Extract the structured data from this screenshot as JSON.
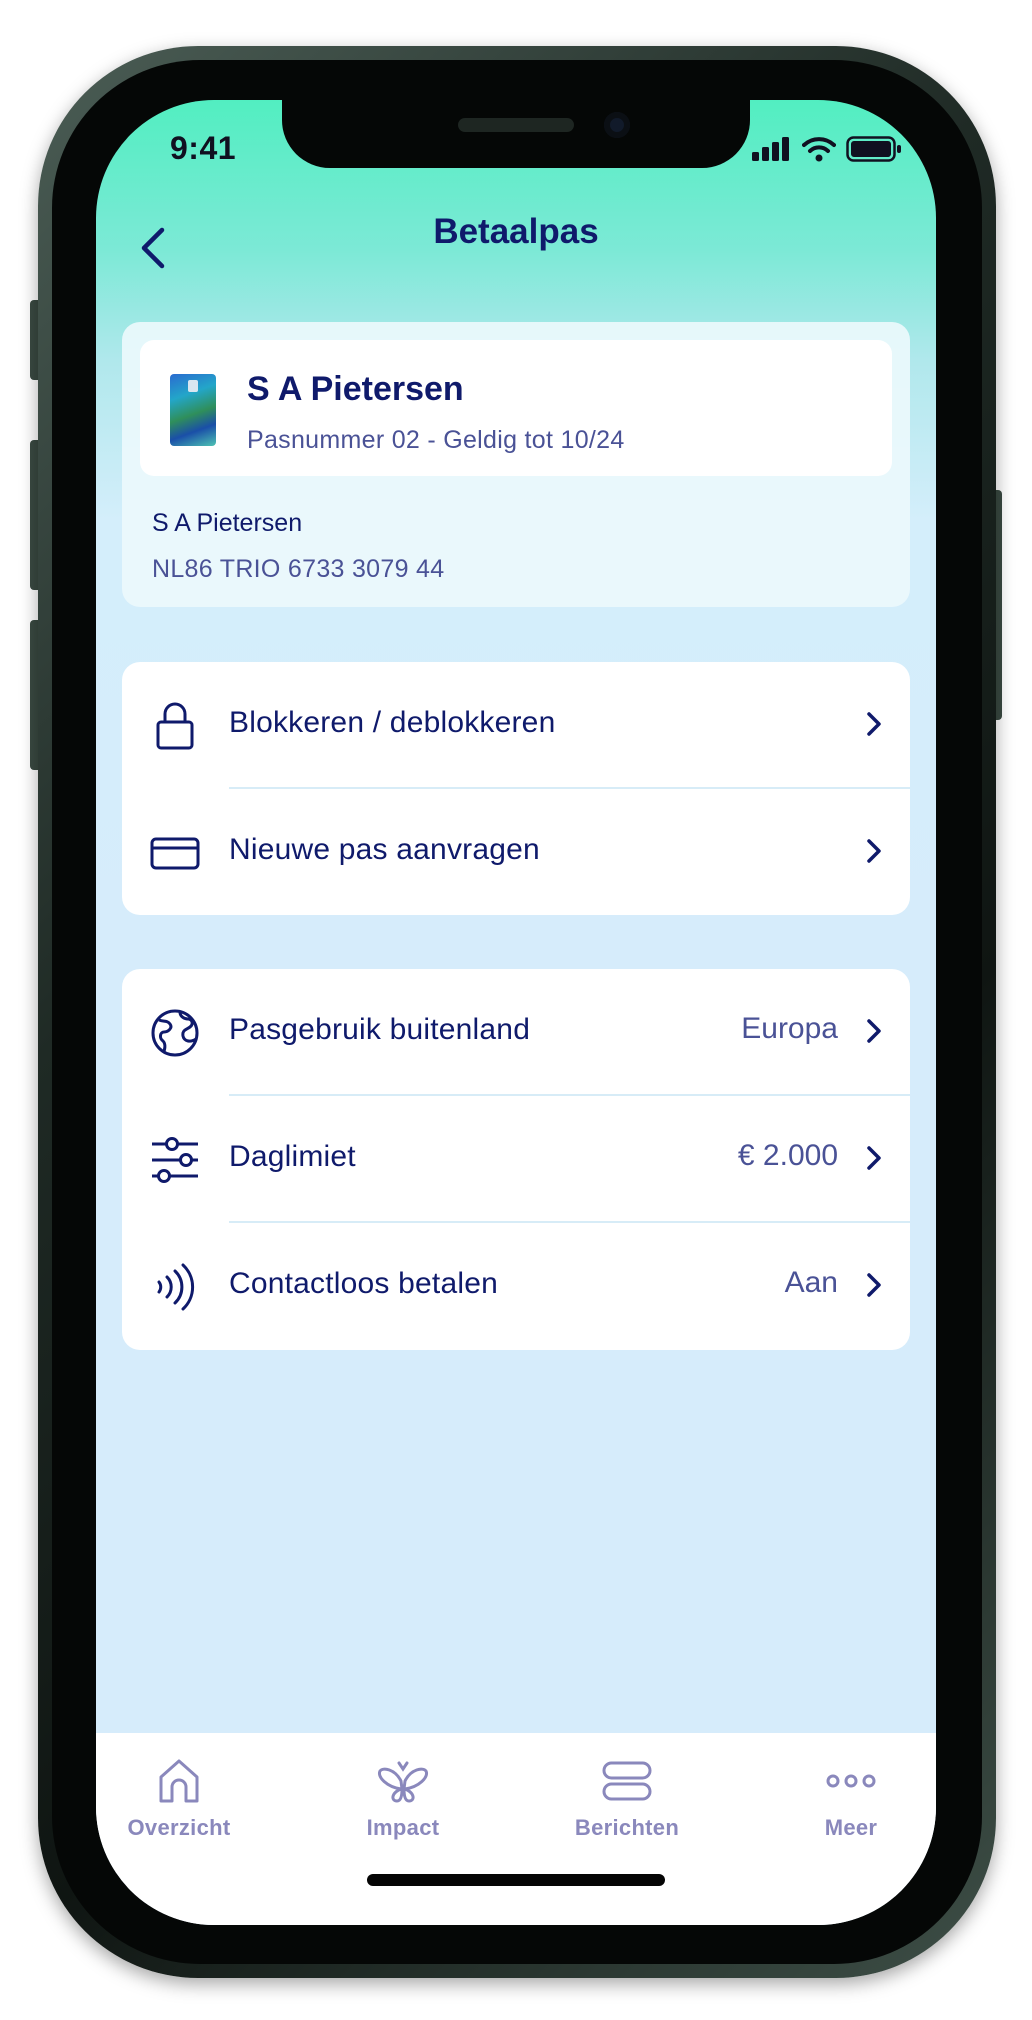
{
  "status_bar": {
    "time": "9:41"
  },
  "header": {
    "title": "Betaalpas",
    "back_icon": "chevron-left-icon"
  },
  "card": {
    "holder_name": "S A Pietersen",
    "meta": "Pasnummer 02 - Geldig tot 10/24",
    "account_name": "S A Pietersen",
    "iban": "NL86 TRIO 6733 3079 44"
  },
  "actions": [
    {
      "label": "Blokkeren / deblokkeren",
      "icon": "lock-icon"
    },
    {
      "label": "Nieuwe pas aanvragen",
      "icon": "card-icon"
    }
  ],
  "settings": [
    {
      "label": "Pasgebruik buitenland",
      "value": "Europa",
      "icon": "globe-icon"
    },
    {
      "label": "Daglimiet",
      "value": "€ 2.000",
      "icon": "sliders-icon"
    },
    {
      "label": "Contactloos betalen",
      "value": "Aan",
      "icon": "contactless-icon"
    }
  ],
  "tabbar": {
    "items": [
      {
        "label": "Overzicht",
        "icon": "home-icon"
      },
      {
        "label": "Impact",
        "icon": "butterfly-icon"
      },
      {
        "label": "Berichten",
        "icon": "messages-icon"
      },
      {
        "label": "Meer",
        "icon": "more-icon"
      }
    ]
  },
  "colors": {
    "primary_text": "#0f1a6b",
    "secondary_text": "#4a5296",
    "header_gradient_top": "#52eec1",
    "background": "#d6ecfb",
    "tab_inactive": "#8a88bc"
  }
}
